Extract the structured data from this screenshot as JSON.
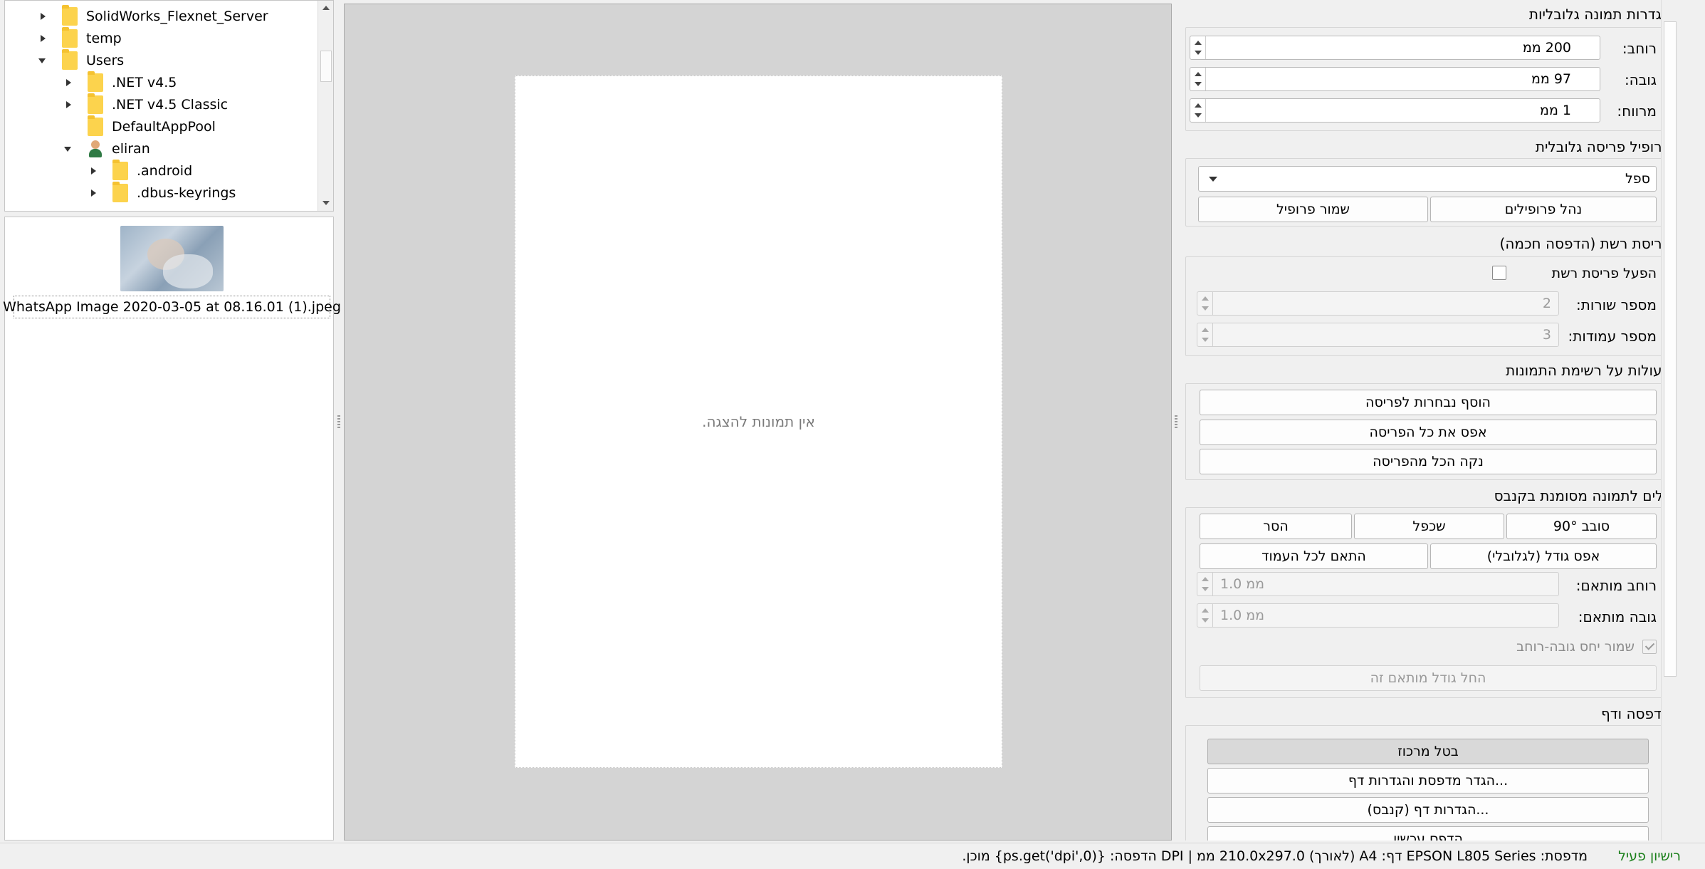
{
  "tree": {
    "items": [
      {
        "label": "SolidWorks_Flexnet_Server",
        "state": "collapsed",
        "icon": "folder-icon"
      },
      {
        "label": "temp",
        "state": "collapsed",
        "icon": "folder-icon"
      },
      {
        "label": "Users",
        "state": "expanded",
        "icon": "folder-icon"
      },
      {
        "label": ".NET v4.5",
        "state": "collapsed",
        "icon": "folder-icon"
      },
      {
        "label": ".NET v4.5 Classic",
        "state": "collapsed",
        "icon": "folder-icon"
      },
      {
        "label": "DefaultAppPool",
        "state": "none",
        "icon": "folder-icon"
      },
      {
        "label": "eliran",
        "state": "expanded",
        "icon": "user-folder-icon"
      },
      {
        "label": ".android",
        "state": "collapsed",
        "icon": "folder-icon"
      },
      {
        "label": ".dbus-keyrings",
        "state": "collapsed",
        "icon": "folder-icon"
      }
    ]
  },
  "thumbnails": {
    "items": [
      {
        "caption": "WhatsApp Image 2020-03-05 at 08.16.01 (1).jpeg"
      }
    ]
  },
  "canvas": {
    "empty_message": "אין תמונות להצגה."
  },
  "panel": {
    "global_size": {
      "title": "הגדרות תמונה גלובליות",
      "width_label": "רוחב:",
      "width_value": "200 ממ",
      "height_label": "גובה:",
      "height_value": "97 ממ",
      "spacing_label": "מרווח:",
      "spacing_value": "1 ממ"
    },
    "profile": {
      "title": "פרופיל פריסה גלובלית",
      "selected": "ספל",
      "manage_label": "נהל פרופילים",
      "save_label": "שמור פרופיל"
    },
    "grid": {
      "title": "פריסת רשת (הדפסה חכמה)",
      "enable_label": "הפעל פריסת רשת",
      "rows_label": "מספר שורות:",
      "rows_value": "2",
      "cols_label": "מספר עמודות:",
      "cols_value": "3"
    },
    "list_actions": {
      "title": "פעולות על רשימת התמונות",
      "add_label": "הוסף נבחרות לפריסה",
      "reset_label": "אפס את כל הפריסה",
      "clear_label": "נקה הכל מהפריסה"
    },
    "canvas_tools": {
      "title": "כלים לתמונה מסומנת בקנבס",
      "rotate_label": "סובב 90°",
      "duplicate_label": "שכפל",
      "remove_label": "הסר",
      "reset_size_label": "אפס גודל (לגלובלי)",
      "fit_page_label": "התאם לכל העמוד",
      "custom_width_label": "רוחב מותאם:",
      "custom_width_value": "1.0 ממ",
      "custom_height_label": "גובה מותאם:",
      "custom_height_value": "1.0 ממ",
      "keep_ratio_label": "שמור יחס גובה-רוחב",
      "apply_custom_label": "החל גודל מותאם זה"
    },
    "print": {
      "title": "הדפסה ודף",
      "uncenter_label": "בטל מרכוז",
      "printer_setup_label": "...הגדר מדפסת והגדרות דף",
      "page_setup_label": "...הגדרות דף (קנבס)",
      "print_now_label": "הדפס עכשיו"
    }
  },
  "status": {
    "license": "רישיון פעיל",
    "info": "מדפסת: EPSON L805 Series   דף: A4 (לאורך) 210.0x297.0 ממ | DPI הדפסה: {ps.get('dpi',0)}  מוכן.",
    "license_color": "#1a7f1a"
  }
}
